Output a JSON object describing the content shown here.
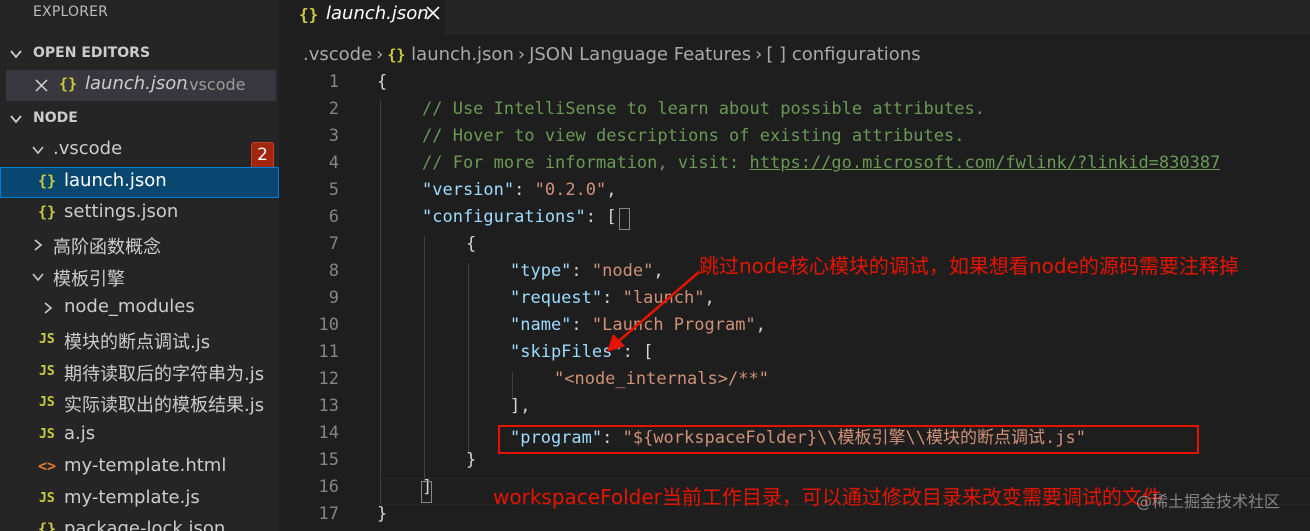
{
  "sidebar": {
    "title": "EXPLORER",
    "open_editors": {
      "label": "OPEN EDITORS",
      "item": {
        "icon": "{}",
        "name": "launch.json",
        "folder": ".vscode"
      }
    },
    "folder": {
      "label": "NODE",
      "items": [
        {
          "kind": "folder",
          "name": ".vscode"
        },
        {
          "kind": "json",
          "icon": "{}",
          "name": "launch.json"
        },
        {
          "kind": "json",
          "icon": "{}",
          "name": "settings.json"
        },
        {
          "kind": "folder-collapsed",
          "name": "高阶函数概念"
        },
        {
          "kind": "folder",
          "name": "模板引擎"
        },
        {
          "kind": "folder-collapsed",
          "name": "node_modules"
        },
        {
          "kind": "js",
          "icon": "JS",
          "name": "模块的断点调试.js"
        },
        {
          "kind": "js",
          "icon": "JS",
          "name": "期待读取后的字符串为.js"
        },
        {
          "kind": "js",
          "icon": "JS",
          "name": "实际读取出的模板结果.js"
        },
        {
          "kind": "js",
          "icon": "JS",
          "name": "a.js"
        },
        {
          "kind": "html",
          "icon": "<>",
          "name": "my-template.html"
        },
        {
          "kind": "js",
          "icon": "JS",
          "name": "my-template.js"
        },
        {
          "kind": "json",
          "icon": "{}",
          "name": "package-lock.json"
        }
      ],
      "badge": "2"
    }
  },
  "editor": {
    "tab": {
      "icon": "{}",
      "name": "launch.json"
    },
    "breadcrumb": {
      "folder": ".vscode",
      "file_icon": "{}",
      "file": "launch.json",
      "section": "JSON Language Features",
      "array_icon": "[ ]",
      "node": "configurations"
    },
    "line_numbers": [
      "1",
      "2",
      "3",
      "4",
      "5",
      "6",
      "7",
      "8",
      "9",
      "10",
      "11",
      "12",
      "13",
      "14",
      "15",
      "16",
      "17"
    ],
    "code": {
      "l1": "{",
      "l2": "// Use IntelliSense to learn about possible attributes.",
      "l3": "// Hover to view descriptions of existing attributes.",
      "l4_comment": "// For more information, visit: ",
      "l4_url": "https://go.microsoft.com/fwlink/?linkid=830387",
      "version_key": "\"version\"",
      "version_val": "\"0.2.0\"",
      "configurations_key": "\"configurations\"",
      "type_key": "\"type\"",
      "type_val": "\"node\"",
      "request_key": "\"request\"",
      "request_val": "\"launch\"",
      "name_key": "\"name\"",
      "name_val": "\"Launch Program\"",
      "skipfiles_key": "\"skipFiles\"",
      "skipfiles_val": "\"<node_internals>/**\"",
      "program_key": "\"program\"",
      "program_val": "\"${workspaceFolder}\\\\模板引擎\\\\模块的断点调试.js\""
    },
    "annotations": {
      "skipfiles_note": "跳过node核心模块的调试，如果想看node的源码需要注释掉",
      "workspace_note": "workspaceFolder当前工作目录，可以通过修改目录来改变需要调试的文件"
    },
    "watermark": "@稀土掘金技术社区"
  },
  "colors": {
    "annotation": "#e51400",
    "selected_item": "#094771",
    "badge": "#a1260d"
  }
}
